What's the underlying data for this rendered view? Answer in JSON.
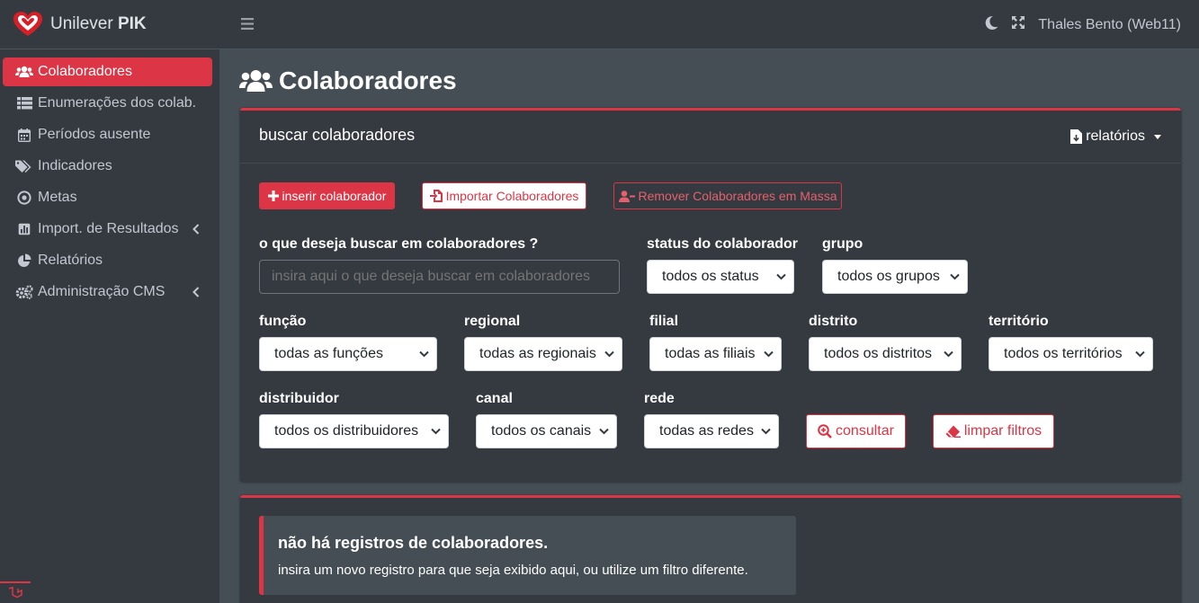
{
  "brand": {
    "name_regular": "Unilever ",
    "name_bold": "PIK"
  },
  "sidebar": {
    "items": [
      {
        "label": "Colaboradores",
        "icon": "users-icon",
        "active": true
      },
      {
        "label": "Enumerações dos colab.",
        "icon": "list-icon"
      },
      {
        "label": "Períodos ausente",
        "icon": "calendar-icon"
      },
      {
        "label": "Indicadores",
        "icon": "tags-icon"
      },
      {
        "label": "Metas",
        "icon": "target-icon"
      },
      {
        "label": "Import. de Resultados",
        "icon": "bar-chart-icon",
        "expandable": true
      },
      {
        "label": "Relatórios",
        "icon": "pie-chart-icon"
      },
      {
        "label": "Administração CMS",
        "icon": "gears-icon",
        "expandable": true
      }
    ]
  },
  "topbar": {
    "user": "Thales Bento (Web11)"
  },
  "page": {
    "title": "Colaboradores"
  },
  "search_card": {
    "title": "buscar colaboradores",
    "reports_label": "relatórios",
    "insert_button": "inserir colaborador",
    "import_button": "Importar Colaboradores",
    "remove_button": "Remover Colaboradores em Massa",
    "query_label": "o que deseja buscar em colaboradores ?",
    "query_placeholder": "insira aqui o que deseja buscar em colaboradores",
    "status_label": "status do colaborador",
    "status_value": "todos os status",
    "group_label": "grupo",
    "group_value": "todos os grupos",
    "function_label": "função",
    "function_value": "todas as funções",
    "regional_label": "regional",
    "regional_value": "todas as regionais",
    "branch_label": "filial",
    "branch_value": "todas as filiais",
    "district_label": "distrito",
    "district_value": "todos os distritos",
    "territory_label": "território",
    "territory_value": "todos os territórios",
    "distributor_label": "distribuidor",
    "distributor_value": "todos os distribuidores",
    "channel_label": "canal",
    "channel_value": "todos os canais",
    "network_label": "rede",
    "network_value": "todas as redes",
    "consult_button": "consultar",
    "clear_button": "limpar filtros"
  },
  "empty_state": {
    "title": "não há registros de colaboradores.",
    "text": "insira um novo registro para que seja exibido aqui, ou utilize um filtro diferente."
  },
  "colors": {
    "accent": "#dc3545",
    "sidebar": "#343a40",
    "content_bg": "#454d55"
  }
}
